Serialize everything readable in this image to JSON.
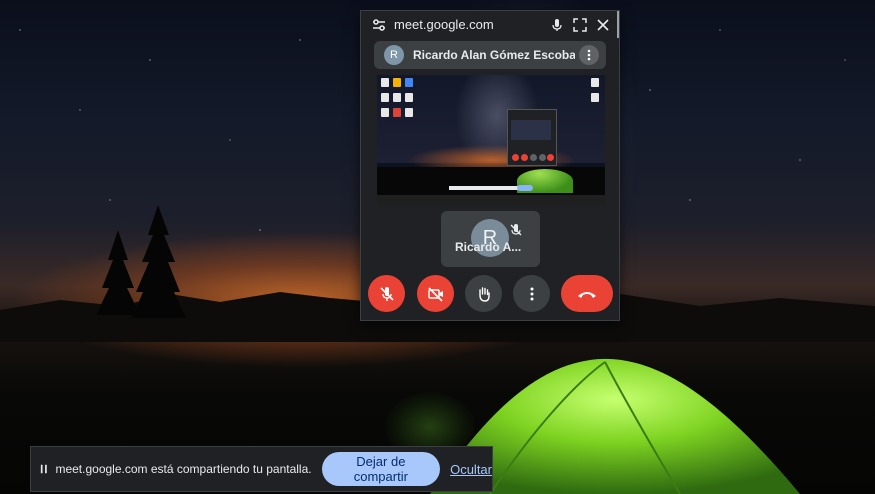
{
  "meet_window": {
    "url": "meet.google.com",
    "presenter": {
      "avatar_initial": "R",
      "name": "Ricardo Alan Gómez Escobar ..."
    },
    "self_tile": {
      "avatar_initial": "R",
      "name": "Ricardo A..."
    },
    "controls": [
      "mic-off-icon",
      "camera-off-icon",
      "raise-hand-icon",
      "more-options-icon",
      "end-call-icon"
    ]
  },
  "share_bar": {
    "message": "meet.google.com está compartiendo tu pantalla.",
    "stop_label": "Dejar de compartir",
    "hide_label": "Ocultar"
  },
  "colors": {
    "accent_red": "#ea4335",
    "button_blue": "#a8c7fa",
    "panel_dark": "#202124",
    "tent_green": "#7ed321"
  }
}
